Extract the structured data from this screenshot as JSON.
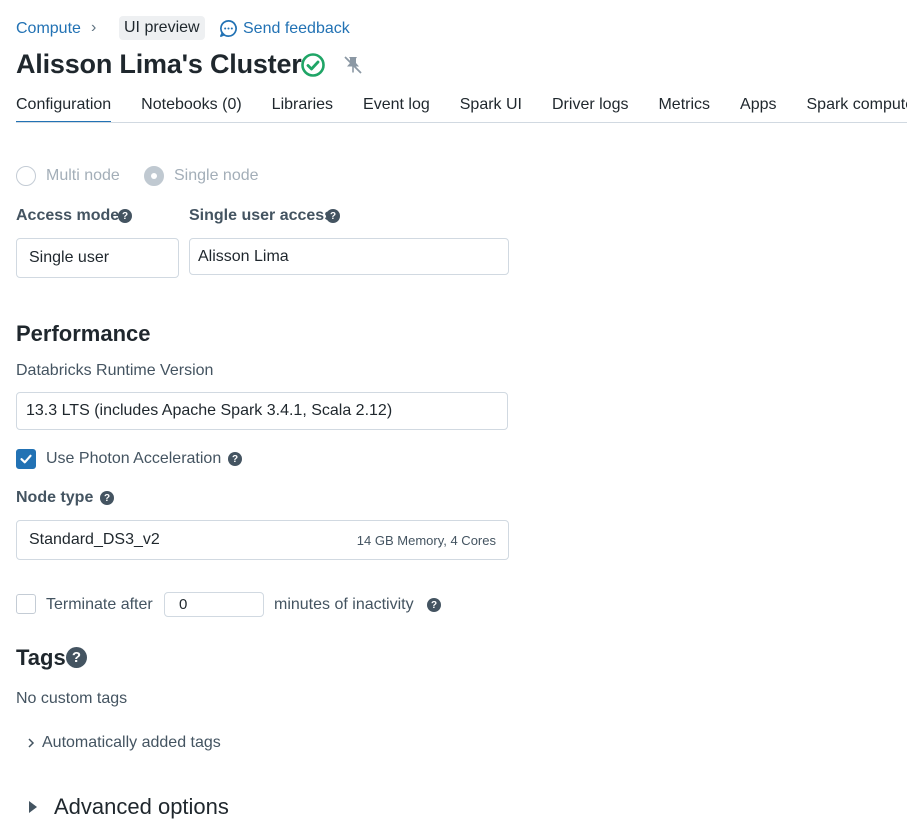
{
  "breadcrumb": {
    "compute_label": "Compute",
    "separator": "›",
    "preview_label": "UI preview",
    "feedback_label": "Send feedback"
  },
  "header": {
    "title": "Alisson Lima's Cluster",
    "status": "running",
    "status_color": "#1fa566"
  },
  "tabs": [
    {
      "label": "Configuration",
      "active": true
    },
    {
      "label": "Notebooks (0)"
    },
    {
      "label": "Libraries"
    },
    {
      "label": "Event log"
    },
    {
      "label": "Spark UI"
    },
    {
      "label": "Driver logs"
    },
    {
      "label": "Metrics"
    },
    {
      "label": "Apps"
    },
    {
      "label": "Spark compute UI - Master"
    }
  ],
  "node_mode": {
    "multi_label": "Multi node",
    "single_label": "Single node",
    "selected": "single"
  },
  "access": {
    "mode_label": "Access mode",
    "mode_value": "Single user",
    "user_label": "Single user access",
    "user_value": "Alisson Lima"
  },
  "performance": {
    "heading": "Performance",
    "runtime_label": "Databricks Runtime Version",
    "runtime_value": "13.3 LTS (includes Apache Spark 3.4.1, Scala 2.12)",
    "photon_label": "Use Photon Acceleration",
    "photon_checked": true,
    "node_type_label": "Node type",
    "node_type_value": "Standard_DS3_v2",
    "node_type_specs": "14 GB Memory, 4 Cores",
    "terminate_label": "Terminate after",
    "terminate_value": "0",
    "terminate_suffix": "minutes of inactivity",
    "terminate_checked": false
  },
  "tags": {
    "heading": "Tags",
    "empty_text": "No custom tags",
    "auto_label": "Automatically added tags"
  },
  "advanced": {
    "label": "Advanced options"
  },
  "colors": {
    "link": "#2272b4",
    "accent": "#2272b4",
    "success": "#1fa566"
  }
}
